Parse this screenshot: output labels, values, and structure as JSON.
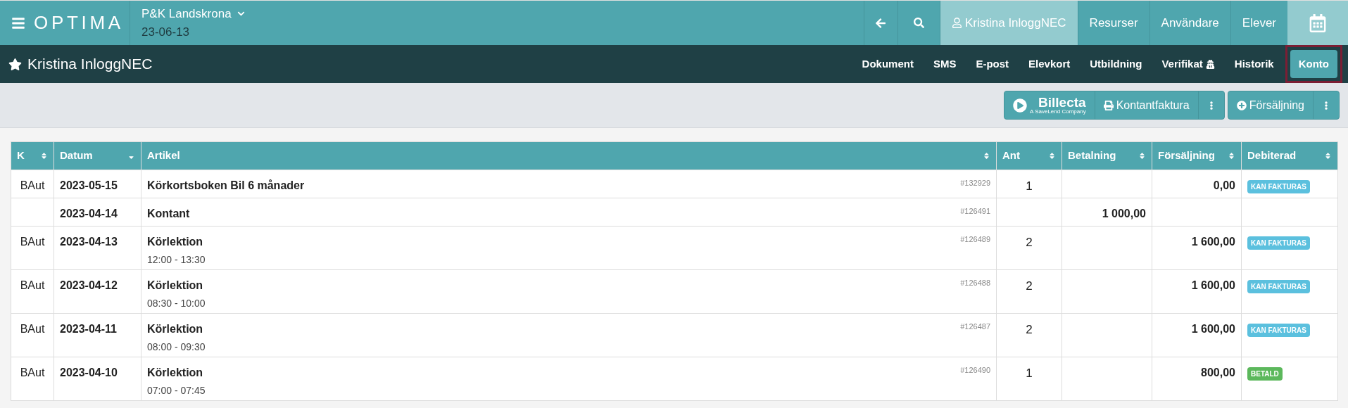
{
  "header": {
    "logo": "OPTIMA",
    "location": "P&K Landskrona",
    "date": "23-06-13",
    "nav": [
      {
        "kind": "back"
      },
      {
        "kind": "search"
      },
      {
        "kind": "user",
        "label": "Kristina InloggNEC",
        "selected": true
      },
      {
        "kind": "text",
        "label": "Resurser",
        "selected": false
      },
      {
        "kind": "text",
        "label": "Användare",
        "selected": false
      },
      {
        "kind": "text",
        "label": "Elever",
        "selected": false
      },
      {
        "kind": "calendar",
        "selected": true
      }
    ]
  },
  "subheader": {
    "title": "Kristina InloggNEC",
    "tabs": [
      {
        "label": "Dokument",
        "selected": false,
        "highlighted": false
      },
      {
        "label": "SMS",
        "selected": false,
        "highlighted": false
      },
      {
        "label": "E-post",
        "selected": false,
        "highlighted": false
      },
      {
        "label": "Elevkort",
        "selected": false,
        "highlighted": false
      },
      {
        "label": "Utbildning",
        "selected": false,
        "highlighted": false
      },
      {
        "label": "Verifikat",
        "kind": "locked",
        "selected": false,
        "highlighted": false
      },
      {
        "label": "Historik",
        "selected": false,
        "highlighted": false
      },
      {
        "label": "Konto",
        "selected": true,
        "highlighted": true
      }
    ]
  },
  "toolbar": {
    "billecta": {
      "label": "Billecta",
      "tagline": "A SaveLend Company"
    },
    "cash_invoice": "Kontantfaktura",
    "sale": "Försäljning"
  },
  "table": {
    "columns": [
      {
        "label": "K",
        "sorted": false
      },
      {
        "label": "Datum",
        "sorted": true
      },
      {
        "label": "Artikel",
        "sorted": false
      },
      {
        "label": "Ant",
        "sorted": false
      },
      {
        "label": "Betalning",
        "sorted": false
      },
      {
        "label": "Försäljning",
        "sorted": false
      },
      {
        "label": "Debiterad",
        "sorted": false
      }
    ],
    "rows": [
      {
        "k": "BAut",
        "date": "2023-05-15",
        "article": "Körkortsboken Bil 6 månader",
        "ref": "#132929",
        "ant": "1",
        "payment": "",
        "sale": "0,00",
        "status": {
          "label": "KAN FAKTURAS",
          "color": "#5bc0de"
        }
      },
      {
        "k": "",
        "date": "2023-04-14",
        "article": "Kontant",
        "ref": "#126491",
        "ant": "",
        "payment": "1 000,00",
        "sale": ""
      },
      {
        "k": "BAut",
        "date": "2023-04-13",
        "article": "Körlektion",
        "time": "12:00 - 13:30",
        "ref": "#126489",
        "ant": "2",
        "payment": "",
        "sale": "1 600,00",
        "status": {
          "label": "KAN FAKTURAS",
          "color": "#5bc0de"
        }
      },
      {
        "k": "BAut",
        "date": "2023-04-12",
        "article": "Körlektion",
        "time": "08:30 - 10:00",
        "ref": "#126488",
        "ant": "2",
        "payment": "",
        "sale": "1 600,00",
        "status": {
          "label": "KAN FAKTURAS",
          "color": "#5bc0de"
        }
      },
      {
        "k": "BAut",
        "date": "2023-04-11",
        "article": "Körlektion",
        "time": "08:00 - 09:30",
        "ref": "#126487",
        "ant": "2",
        "payment": "",
        "sale": "1 600,00",
        "status": {
          "label": "KAN FAKTURAS",
          "color": "#5bc0de"
        }
      },
      {
        "k": "BAut",
        "date": "2023-04-10",
        "article": "Körlektion",
        "time": "07:00 - 07:45",
        "ref": "#126490",
        "ant": "1",
        "payment": "",
        "sale": "800,00",
        "status": {
          "label": "BETALD",
          "color": "#5cb85c"
        }
      }
    ]
  }
}
